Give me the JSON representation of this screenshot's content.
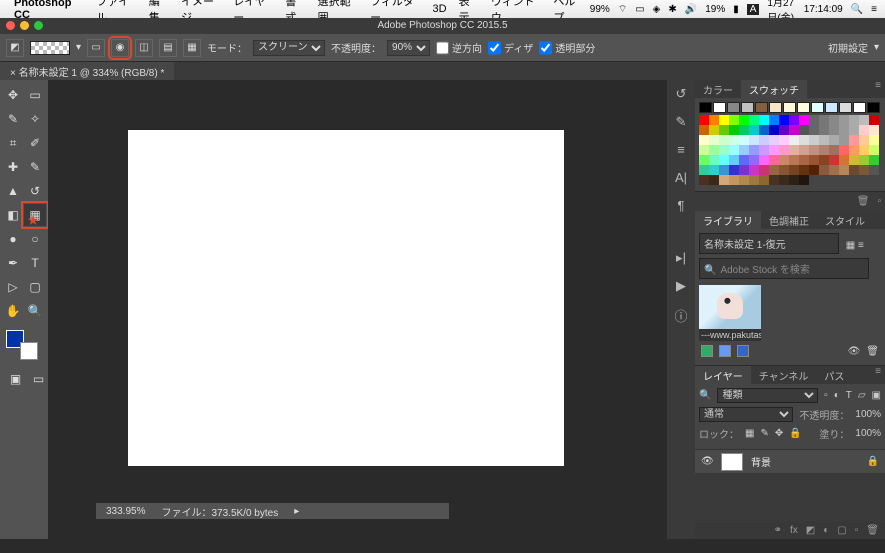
{
  "mac_menu": {
    "app": "Photoshop CC",
    "items": [
      "ファイル",
      "編集",
      "イメージ",
      "レイヤー",
      "書式",
      "選択範囲",
      "フィルター",
      "3D",
      "表示",
      "ウィンドウ",
      "ヘルプ"
    ],
    "right": {
      "battery": "19%",
      "kbd": "A",
      "date": "1月27日(金)",
      "time": "17:14:09"
    }
  },
  "window_title": "Adobe Photoshop CC 2015.5",
  "options": {
    "mode_label": "モード：",
    "mode_value": "スクリーン",
    "opacity_label": "不透明度：",
    "opacity_value": "90%",
    "reverse": "逆方向",
    "dither": "ディザ",
    "transparency": "透明部分",
    "reset": "初期設定"
  },
  "doc_tab": "名称未設定 1 @ 334% (RGB/8) *",
  "swatch_tabs": {
    "color": "カラー",
    "swatch": "スウォッチ"
  },
  "library": {
    "tabs": {
      "lib": "ライブラリ",
      "adj": "色調補正",
      "style": "スタイル"
    },
    "select": "名称未設定 1-復元",
    "search_placeholder": "Adobe Stock を検索",
    "thumb_caption": "---www.pakutaso...."
  },
  "layers": {
    "tabs": {
      "layer": "レイヤー",
      "channel": "チャンネル",
      "path": "パス"
    },
    "kind": "種類",
    "blend": "通常",
    "opacity_label": "不透明度：",
    "opacity_value": "100%",
    "lock_label": "ロック：",
    "fill_label": "塗り：",
    "fill_value": "100%",
    "bg_layer": "背景"
  },
  "status": {
    "zoom": "333.95%",
    "file": "ファイル：373.5K/0 bytes"
  },
  "swatch_basic": [
    "#000000",
    "#ffffff",
    "#888888",
    "#c0c0c0",
    "#806040",
    "#f5e6c8",
    "#fff8dc",
    "#ffffe0",
    "#e0ffff",
    "#d0e8ff",
    "#dcdcdc",
    "#ffffff",
    "#000000"
  ],
  "swatch_rows": [
    [
      "#ff0000",
      "#ff8000",
      "#ffff00",
      "#80ff00",
      "#00ff00",
      "#00ff80",
      "#00ffff",
      "#0080ff",
      "#0000ff",
      "#8000ff",
      "#ff00ff",
      "#666",
      "#777",
      "#888",
      "#999",
      "#aaa",
      "#bbb"
    ],
    [
      "#cc0000",
      "#cc6600",
      "#cccc00",
      "#66cc00",
      "#00cc00",
      "#00cc66",
      "#00cccc",
      "#0066cc",
      "#0000cc",
      "#6600cc",
      "#cc00cc",
      "#555",
      "#666",
      "#777",
      "#888",
      "#999",
      "#aaa"
    ],
    [
      "#ffcccc",
      "#ffe6cc",
      "#ffffcc",
      "#e6ffcc",
      "#ccffcc",
      "#ccffe6",
      "#ccffff",
      "#cce6ff",
      "#ccccff",
      "#e6ccff",
      "#ffccff",
      "#eee",
      "#ddd",
      "#ccc",
      "#bbb",
      "#aaa",
      "#999"
    ],
    [
      "#ff9999",
      "#ffcc99",
      "#ffff99",
      "#ccff99",
      "#99ff99",
      "#99ffcc",
      "#99ffff",
      "#99ccff",
      "#9999ff",
      "#cc99ff",
      "#ff99ff",
      "#ff99cc",
      "#e0b0a0",
      "#d0a090",
      "#c09080",
      "#b08070",
      "#a07060"
    ],
    [
      "#ff6666",
      "#ff9966",
      "#ffcc66",
      "#ccff66",
      "#66ff66",
      "#66ffcc",
      "#66ffff",
      "#66ccff",
      "#6666ff",
      "#9966ff",
      "#ff66ff",
      "#ff6699",
      "#cc8866",
      "#bb7755",
      "#aa6644",
      "#995533",
      "#884422"
    ],
    [
      "#cc3333",
      "#cc7733",
      "#ccbb33",
      "#99cc33",
      "#33cc33",
      "#33cc99",
      "#33cccc",
      "#3399cc",
      "#3333cc",
      "#7733cc",
      "#cc33cc",
      "#cc3377",
      "#996644",
      "#885533",
      "#774422",
      "#663311",
      "#552200"
    ],
    [
      "#8b5a3c",
      "#a0704c",
      "#b5865c",
      "#6b4a30",
      "#7d5838",
      "#555",
      "#4a3020",
      "#3a2818",
      "#d4a878",
      "#c29860",
      "#b08850",
      "#9e7840",
      "#8c6830",
      "#473223",
      "#3a2a1c",
      "#2d2015",
      "#20160e"
    ]
  ]
}
